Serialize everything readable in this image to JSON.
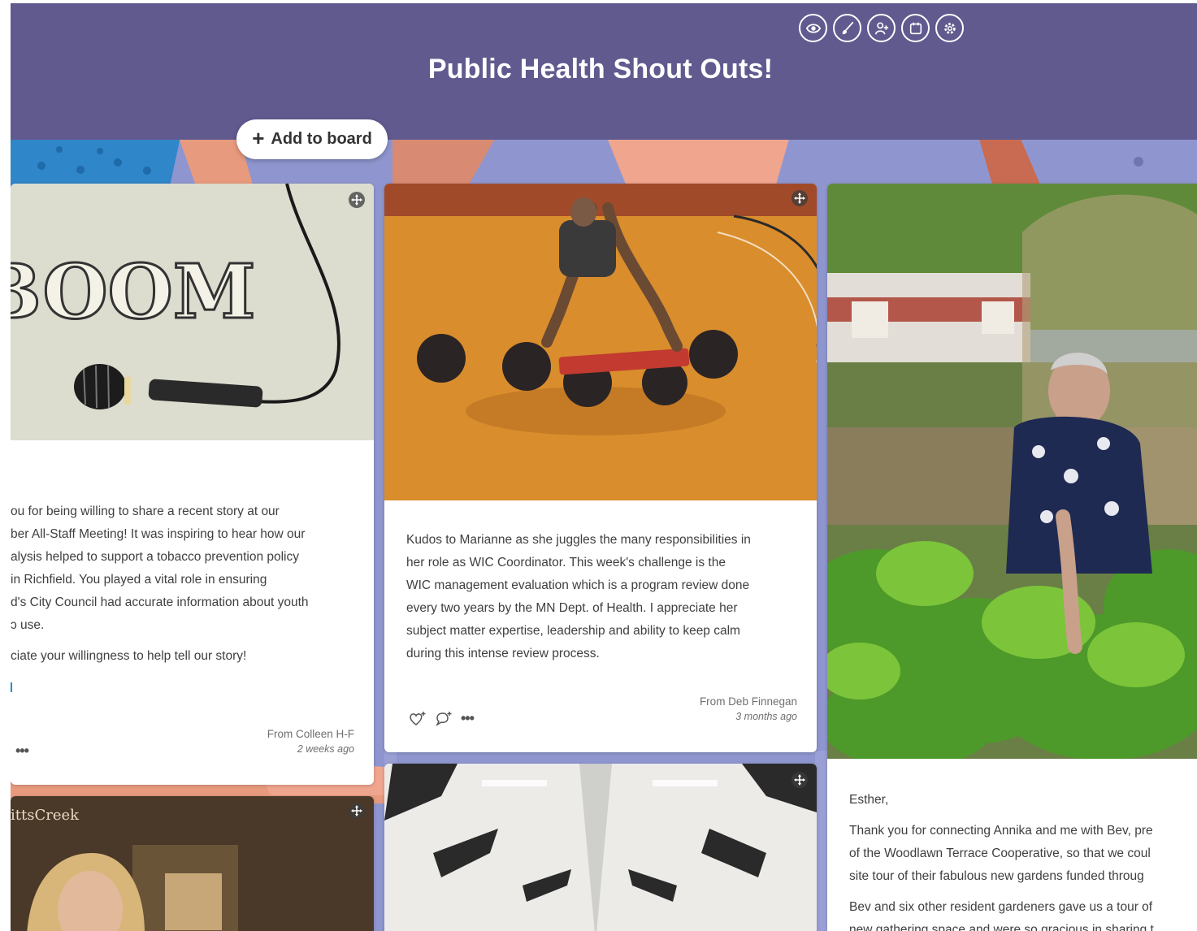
{
  "board": {
    "title": "Public Health Shout Outs!",
    "add_label": "Add to board"
  },
  "toolbar": {
    "icons": [
      "eye-icon",
      "brush-icon",
      "add-user-icon",
      "calendar-icon",
      "gear-icon"
    ]
  },
  "cards": [
    {
      "image_text": "BOOM",
      "paragraphs": [
        "ou for being willing to share a recent story at our",
        "ber All-Staff Meeting! It was inspiring to hear how our",
        "alysis helped to support a tobacco prevention policy",
        " in Richfield. You played a vital role in ensuring",
        "d's City Council had accurate information about youth",
        "ɔ use.",
        "ciate your willingness to help tell our story!"
      ],
      "from": "From Colleen H-F",
      "ago": "2 weeks ago"
    },
    {
      "paragraph": [
        "Kudos to Marianne as she juggles the many responsibilities in",
        "her role as WIC Coordinator.  This week's challenge is the",
        "WIC management evaluation which is a program review done",
        "every two years by the MN Dept. of Health.  I appreciate her",
        "subject matter expertise, leadership and ability to keep calm",
        "during this intense review process."
      ],
      "from": "From Deb Finnegan",
      "ago": "3 months ago"
    },
    {
      "greeting": "Esther,",
      "paragraphs": [
        "Thank you for connecting Annika and me with Bev, pre",
        "of the Woodlawn Terrace Cooperative, so that we coul",
        "site tour of their fabulous new gardens funded throug",
        "Bev and six other resident gardeners gave us a tour of",
        "new gathering space and were so gracious in sharing t"
      ]
    },
    {
      "image_text": "ittsCreek"
    }
  ],
  "colors": {
    "header": "#605a8f",
    "board_bg": "#8f96cf",
    "card": "#ffffff"
  }
}
